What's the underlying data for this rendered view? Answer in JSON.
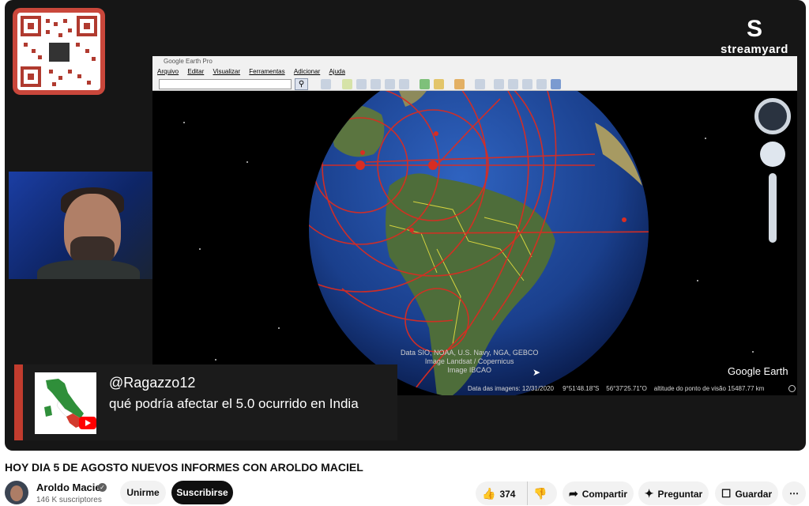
{
  "stream_logo": {
    "mark": "S",
    "word": "streamyard"
  },
  "google_earth": {
    "window_title": "Google Earth Pro",
    "menu": [
      "Arquivo",
      "Editar",
      "Visualizar",
      "Ferramentas",
      "Adicionar",
      "Ajuda"
    ],
    "credits": [
      "Data SIO, NOAA, U.S. Navy, NGA, GEBCO",
      "Image Landsat / Copernicus",
      "Image IBCAO"
    ],
    "logo": "Google Earth",
    "status": {
      "date_label": "Data das imagens: 12/31/2020",
      "lat": "9°51'48.18\"S",
      "lon": "56°37'25.71\"O",
      "altitude": "altitude do ponto de visão 15487.77 km"
    }
  },
  "chat": {
    "user": "@Ragazzo12",
    "message": "qué podría afectar el 5.0 ocurrido en India"
  },
  "video_title": "HOY DIA 5 DE AGOSTO NUEVOS INFORMES CON AROLDO MACIEL",
  "channel": {
    "name": "Aroldo Maciel",
    "subscribers": "146 K suscriptores"
  },
  "actions": {
    "join": "Unirme",
    "subscribe": "Suscribirse",
    "likes": "374",
    "share": "Compartir",
    "ask": "Preguntar",
    "save": "Guardar"
  },
  "colors": {
    "accent": "#c23c2e",
    "globe_ocean": "#1f4fa8",
    "land": "#4e6d3a"
  }
}
